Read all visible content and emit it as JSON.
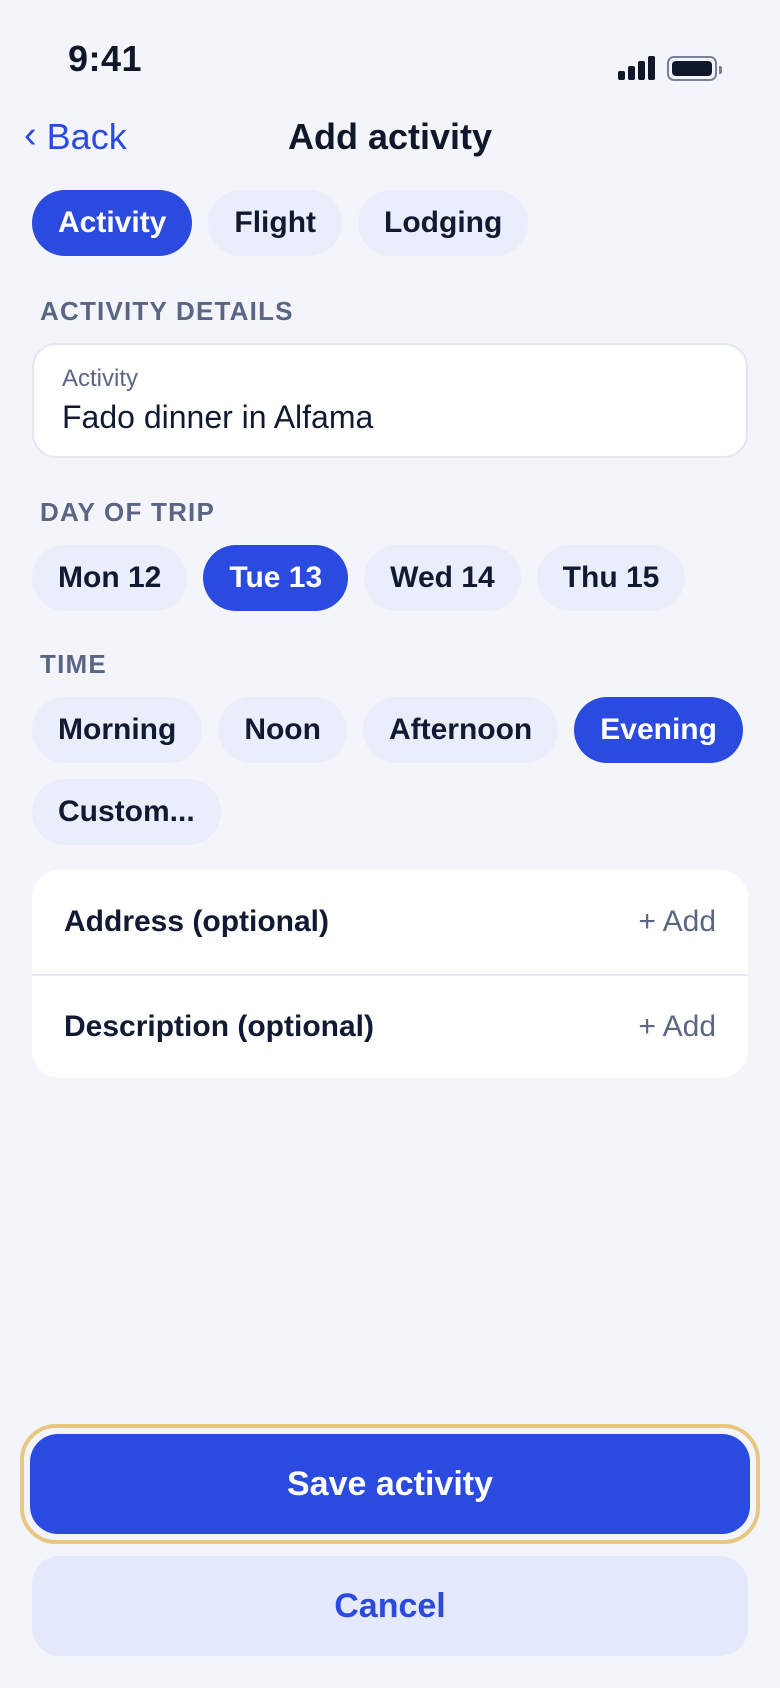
{
  "status_bar": {
    "time": "9:41"
  },
  "nav": {
    "back_label": "Back",
    "title": "Add activity"
  },
  "segments": [
    {
      "label": "Activity",
      "active": true
    },
    {
      "label": "Flight",
      "active": false
    },
    {
      "label": "Lodging",
      "active": false
    }
  ],
  "details": {
    "section_label": "ACTIVITY DETAILS",
    "field_label": "Activity",
    "field_value": "Fado dinner in Alfama"
  },
  "day": {
    "section_label": "DAY OF TRIP",
    "options": [
      {
        "label": "Mon 12",
        "active": false
      },
      {
        "label": "Tue 13",
        "active": true
      },
      {
        "label": "Wed 14",
        "active": false
      },
      {
        "label": "Thu 15",
        "active": false
      }
    ]
  },
  "time": {
    "section_label": "TIME",
    "options": [
      {
        "label": "Morning",
        "active": false
      },
      {
        "label": "Noon",
        "active": false
      },
      {
        "label": "Afternoon",
        "active": false
      },
      {
        "label": "Evening",
        "active": true
      },
      {
        "label": "Custom...",
        "active": false
      }
    ]
  },
  "optional_rows": [
    {
      "label": "Address (optional)",
      "action": "+ Add"
    },
    {
      "label": "Description (optional)",
      "action": "+ Add"
    }
  ],
  "actions": {
    "save_label": "Save activity",
    "cancel_label": "Cancel"
  },
  "colors": {
    "accent": "#2b4ae0",
    "background": "#f3f5fa",
    "focus_ring": "#e6c77f"
  }
}
